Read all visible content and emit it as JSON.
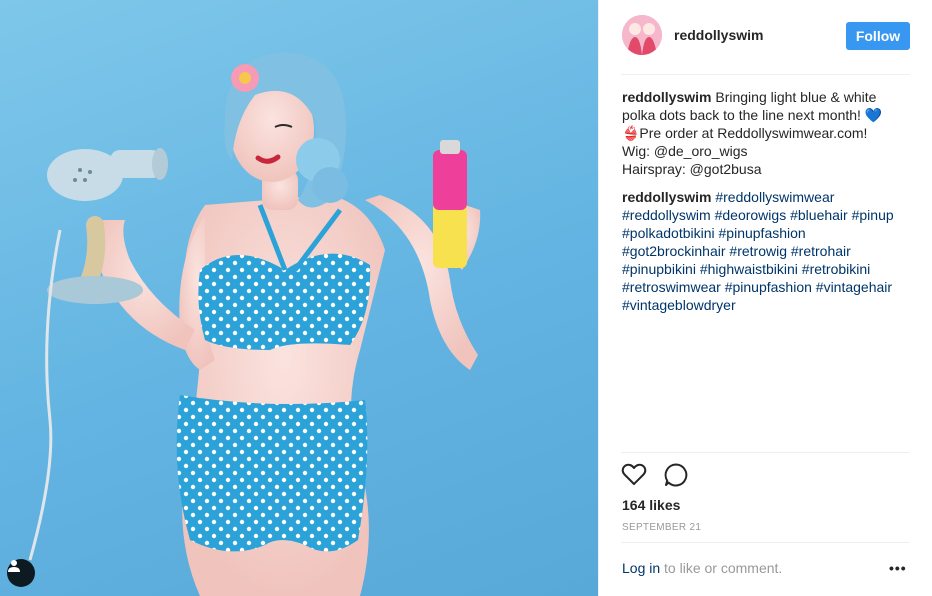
{
  "photo": {
    "alt": "",
    "user_tag_icon": "person-tag-icon"
  },
  "header": {
    "username": "reddollyswim",
    "follow_label": "Follow"
  },
  "caption": {
    "username": "reddollyswim",
    "text": "Bringing light blue & white polka dots back to the line next month! 💙\n👙Pre order at Reddollyswimwear.com!\nWig: @de_oro_wigs\nHairspray: @got2busa"
  },
  "comment": {
    "username": "reddollyswim",
    "hashtags": [
      "#reddollyswimwear",
      "#reddollyswim",
      "#deorowigs",
      "#bluehair",
      "#pinup",
      "#polkadotbikini",
      "#pinupfashion",
      "#got2brockinhair",
      "#retrowig",
      "#retrohair",
      "#pinupbikini",
      "#highwaistbikini",
      "#retrobikini",
      "#retroswimwear",
      "#pinupfashion",
      "#vintagehair",
      "#vintageblowdryer"
    ]
  },
  "actions": {
    "like_icon": "heart-icon",
    "comment_icon": "comment-bubble-icon"
  },
  "likes": "164 likes",
  "date": "SEPTEMBER 21",
  "footer": {
    "login_link": "Log in",
    "login_suffix": " to like or comment.",
    "more_label": "•••"
  },
  "colors": {
    "follow": "#3897f0",
    "link": "#003569",
    "muted": "#999999",
    "backdrop": "#68b8e4"
  }
}
